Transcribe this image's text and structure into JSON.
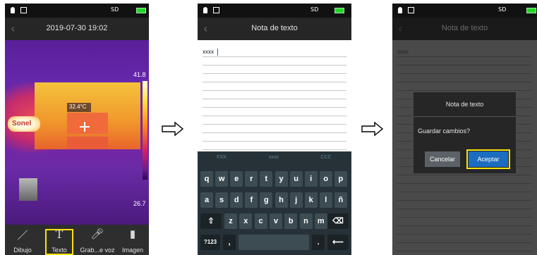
{
  "status_bar": {
    "sd_label": "SD"
  },
  "screen1": {
    "title": "2019-07-30 19:02",
    "temp_max": "41.8",
    "temp_min": "26.7",
    "spot_temp": "32.4°C",
    "logo_text": "Sonel",
    "tools": [
      {
        "label": "Dibujo",
        "icon": "pencil-icon"
      },
      {
        "label": "Texto",
        "icon": "text-T-icon"
      },
      {
        "label": "Grab...e voz",
        "icon": "microphone-icon"
      },
      {
        "label": "Imagen",
        "icon": "image-stack-icon"
      }
    ]
  },
  "screen2": {
    "title": "Nota de texto",
    "note_text": "xxxx",
    "suggestions": [
      "FXX",
      "xxxx",
      "CCC"
    ],
    "keyboard": {
      "row1": [
        "q",
        "w",
        "e",
        "r",
        "t",
        "y",
        "u",
        "i",
        "o",
        "p"
      ],
      "row2": [
        "a",
        "s",
        "d",
        "f",
        "g",
        "h",
        "j",
        "k",
        "l",
        "ñ"
      ],
      "row3": [
        "z",
        "x",
        "c",
        "v",
        "b",
        "n",
        "m"
      ],
      "shift_icon": "shift-icon",
      "backspace_icon": "backspace-icon",
      "symbols_label": "?123",
      "comma_label": ",",
      "period_label": ".",
      "enter_icon": "enter-arrow-icon"
    }
  },
  "screen3": {
    "title": "Nota de texto",
    "note_text": "xxxx",
    "dialog": {
      "title": "Nota de texto",
      "message": "Guardar cambios?",
      "cancel_label": "Cancelar",
      "accept_label": "Aceptar"
    }
  },
  "colors": {
    "highlight": "#f6e20b",
    "accent": "#1c6cc0",
    "battery": "#22d62a"
  }
}
